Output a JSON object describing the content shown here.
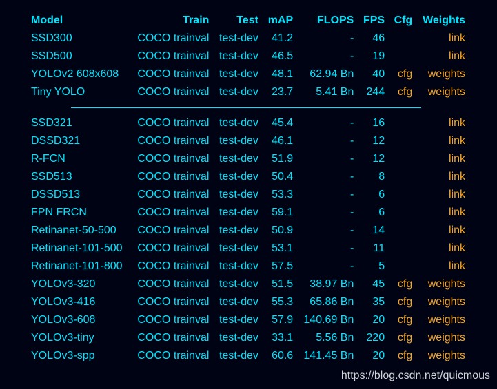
{
  "header": {
    "model": "Model",
    "train": "Train",
    "test": "Test",
    "map": "mAP",
    "flops": "FLOPS",
    "fps": "FPS",
    "cfg": "Cfg",
    "weights": "Weights"
  },
  "group1": [
    {
      "model": "SSD300",
      "train": "COCO trainval",
      "test": "test-dev",
      "map": "41.2",
      "flops": "-",
      "fps": "46",
      "cfg": "",
      "weights": "link"
    },
    {
      "model": "SSD500",
      "train": "COCO trainval",
      "test": "test-dev",
      "map": "46.5",
      "flops": "-",
      "fps": "19",
      "cfg": "",
      "weights": "link"
    },
    {
      "model": "YOLOv2 608x608",
      "train": "COCO trainval",
      "test": "test-dev",
      "map": "48.1",
      "flops": "62.94 Bn",
      "fps": "40",
      "cfg": "cfg",
      "weights": "weights"
    },
    {
      "model": "Tiny YOLO",
      "train": "COCO trainval",
      "test": "test-dev",
      "map": "23.7",
      "flops": "5.41 Bn",
      "fps": "244",
      "cfg": "cfg",
      "weights": "weights"
    }
  ],
  "group2": [
    {
      "model": "SSD321",
      "train": "COCO trainval",
      "test": "test-dev",
      "map": "45.4",
      "flops": "-",
      "fps": "16",
      "cfg": "",
      "weights": "link"
    },
    {
      "model": "DSSD321",
      "train": "COCO trainval",
      "test": "test-dev",
      "map": "46.1",
      "flops": "-",
      "fps": "12",
      "cfg": "",
      "weights": "link"
    },
    {
      "model": "R-FCN",
      "train": "COCO trainval",
      "test": "test-dev",
      "map": "51.9",
      "flops": "-",
      "fps": "12",
      "cfg": "",
      "weights": "link"
    },
    {
      "model": "SSD513",
      "train": "COCO trainval",
      "test": "test-dev",
      "map": "50.4",
      "flops": "-",
      "fps": "8",
      "cfg": "",
      "weights": "link"
    },
    {
      "model": "DSSD513",
      "train": "COCO trainval",
      "test": "test-dev",
      "map": "53.3",
      "flops": "-",
      "fps": "6",
      "cfg": "",
      "weights": "link"
    },
    {
      "model": "FPN FRCN",
      "train": "COCO trainval",
      "test": "test-dev",
      "map": "59.1",
      "flops": "-",
      "fps": "6",
      "cfg": "",
      "weights": "link"
    },
    {
      "model": "Retinanet-50-500",
      "train": "COCO trainval",
      "test": "test-dev",
      "map": "50.9",
      "flops": "-",
      "fps": "14",
      "cfg": "",
      "weights": "link"
    },
    {
      "model": "Retinanet-101-500",
      "train": "COCO trainval",
      "test": "test-dev",
      "map": "53.1",
      "flops": "-",
      "fps": "11",
      "cfg": "",
      "weights": "link"
    },
    {
      "model": "Retinanet-101-800",
      "train": "COCO trainval",
      "test": "test-dev",
      "map": "57.5",
      "flops": "-",
      "fps": "5",
      "cfg": "",
      "weights": "link"
    },
    {
      "model": "YOLOv3-320",
      "train": "COCO trainval",
      "test": "test-dev",
      "map": "51.5",
      "flops": "38.97 Bn",
      "fps": "45",
      "cfg": "cfg",
      "weights": "weights"
    },
    {
      "model": "YOLOv3-416",
      "train": "COCO trainval",
      "test": "test-dev",
      "map": "55.3",
      "flops": "65.86 Bn",
      "fps": "35",
      "cfg": "cfg",
      "weights": "weights"
    },
    {
      "model": "YOLOv3-608",
      "train": "COCO trainval",
      "test": "test-dev",
      "map": "57.9",
      "flops": "140.69 Bn",
      "fps": "20",
      "cfg": "cfg",
      "weights": "weights"
    },
    {
      "model": "YOLOv3-tiny",
      "train": "COCO trainval",
      "test": "test-dev",
      "map": "33.1",
      "flops": "5.56 Bn",
      "fps": "220",
      "cfg": "cfg",
      "weights": "weights"
    },
    {
      "model": "YOLOv3-spp",
      "train": "COCO trainval",
      "test": "test-dev",
      "map": "60.6",
      "flops": "141.45 Bn",
      "fps": "20",
      "cfg": "cfg",
      "weights": "weights"
    }
  ],
  "watermark": "https://blog.csdn.net/quicmous",
  "colors": {
    "background": "#000314",
    "cyan": "#00e5ff",
    "orange": "#f5a623",
    "watermark": "#cfd3da"
  }
}
